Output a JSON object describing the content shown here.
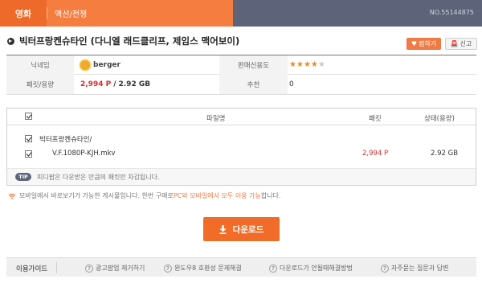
{
  "category": {
    "main": "영화",
    "sub": "액션/전쟁"
  },
  "post_number": "NO.55144875",
  "title": "빅터프랑켄슈타인 (다니엘 래드클리프, 제임스 맥어보이)",
  "actions": {
    "favorite_label": "찜하기",
    "report_label": "신고"
  },
  "info": {
    "nickname_label": "닉네임",
    "nickname": "berger",
    "trust_label": "판매신용도",
    "trust_rating": 4,
    "trust_max": 5,
    "packet_label": "패킷/용량",
    "packet": "2,994 P",
    "size_sep": "/",
    "size": "2.92 GB",
    "recommend_label": "추천",
    "recommend": "0"
  },
  "file_table": {
    "col_filename": "파일명",
    "col_packet": "패킷",
    "col_status": "상태(용량)",
    "rows": [
      {
        "name": "빅터프랑켄슈타인/",
        "packet": "",
        "size": ""
      },
      {
        "name": "V.F.1080P-KJH.mkv",
        "packet": "2,994 P",
        "size": "2.92 GB"
      }
    ],
    "tip_badge": "TIP",
    "tip_text": "피디팜은 다운받은 만큼의 패킷만 차감됩니다."
  },
  "mobile_note": {
    "before": "모바일에서 바로보기가 가능한 게시물입니다. 한번 구매로 ",
    "highlight": "PC와 모바일에서 모두 이용 가능",
    "after": "합니다."
  },
  "download_label": "다운로드",
  "guide": {
    "label": "이용가이드",
    "items": [
      "광고팝업 제거하기",
      "윈도우8 호환성 문제해결",
      "다운로드가 안될때해결방법",
      "자주묻는 질문과 답변"
    ]
  },
  "colors": {
    "accent": "#ef7a43",
    "packet_red": "#d72c2c",
    "dark_bar": "#5d6479"
  }
}
